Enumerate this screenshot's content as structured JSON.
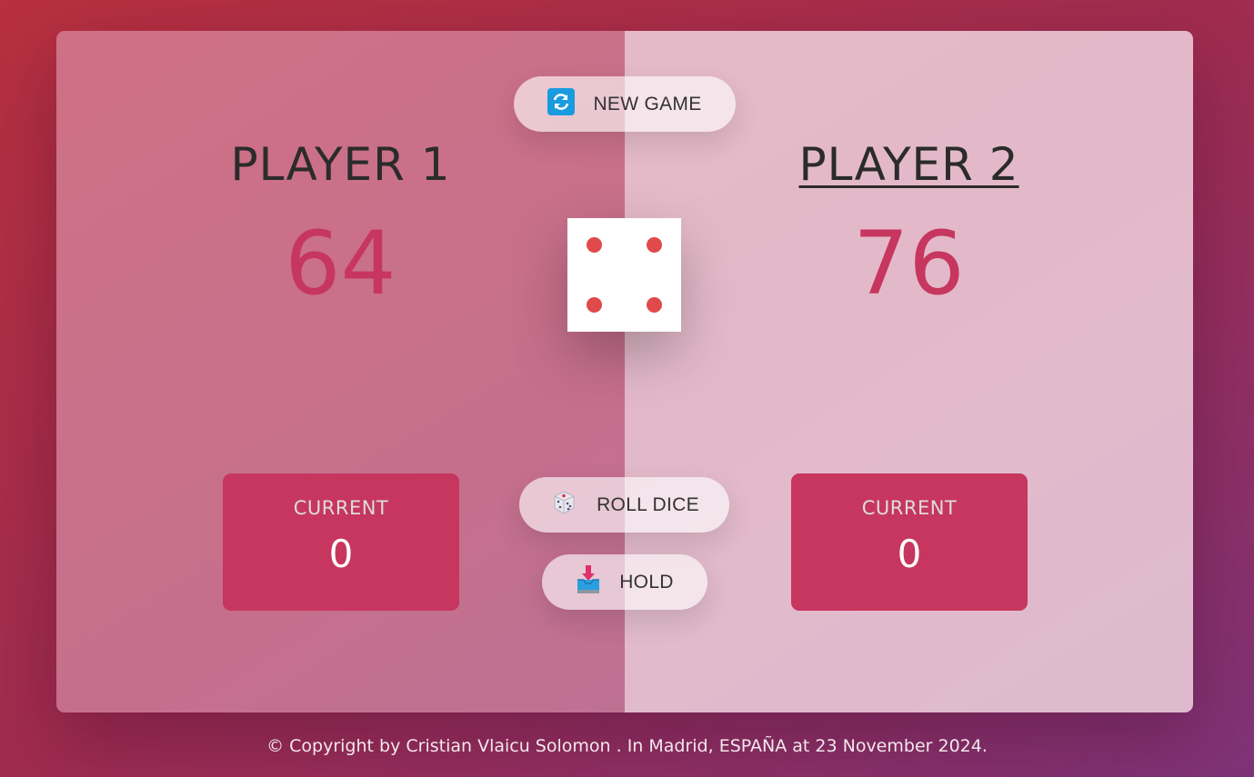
{
  "buttons": {
    "new_game": "NEW GAME",
    "roll_dice": "ROLL DICE",
    "hold": "HOLD"
  },
  "players": [
    {
      "name": "PLAYER 1",
      "score": "64",
      "current_label": "CURRENT",
      "current_score": "0",
      "active": false
    },
    {
      "name": "PLAYER 2",
      "score": "76",
      "current_label": "CURRENT",
      "current_score": "0",
      "active": true
    }
  ],
  "dice": {
    "value": 4
  },
  "icons": {
    "new_game": "refresh-icon",
    "roll_dice": "dice-icon",
    "hold": "inbox-tray-icon"
  },
  "colors": {
    "accent": "#c7365f",
    "pip": "#e04a4a"
  },
  "footer": "© Copyright by Cristian Vlaicu Solomon . In Madrid, ESPAÑA at 23 November 2024."
}
